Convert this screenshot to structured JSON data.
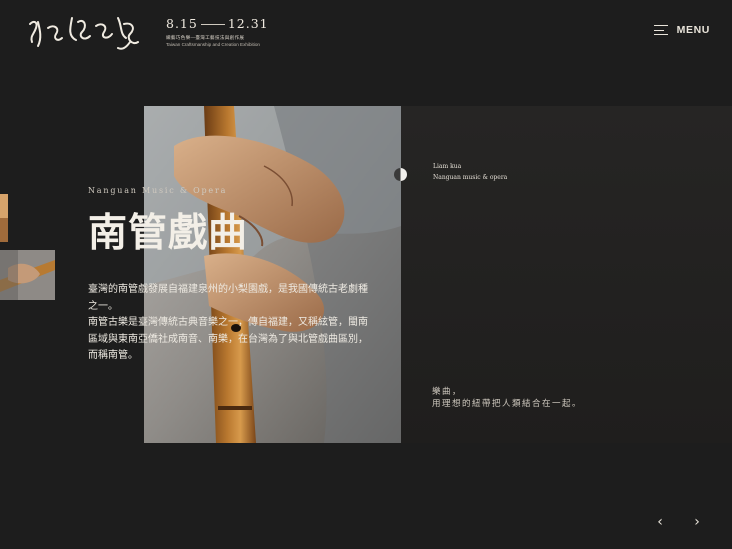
{
  "header": {
    "dates": {
      "start": "8.15",
      "end": "12.31"
    },
    "subtitle_zh": "織藝巧色樂—臺灣工藝技法與創作展",
    "subtitle_en": "Taiwan Craftsmanship and Creation Exhibition",
    "menu_label": "MENU"
  },
  "slide": {
    "eyebrow": "Nanguan Music & Opera",
    "title": "南管戲曲",
    "paragraphs": [
      "臺灣的南管戲發展自福建泉州的小梨園戲，是我國傳統古老劇種之一。",
      "南管古樂是臺灣傳統古典音樂之一，傳自福建，又稱絃管，閩南區域與東南亞僑社成南音、南樂，在台灣為了與北管戲曲區別，而稱南管。"
    ],
    "side_name": "Liam kua",
    "side_sub": "Nanguan music & opera",
    "quote_line1": "樂曲，",
    "quote_line2": "用理想的紐帶把人類結合在一起。"
  },
  "nav": {
    "prev": "‹",
    "next": "›"
  }
}
